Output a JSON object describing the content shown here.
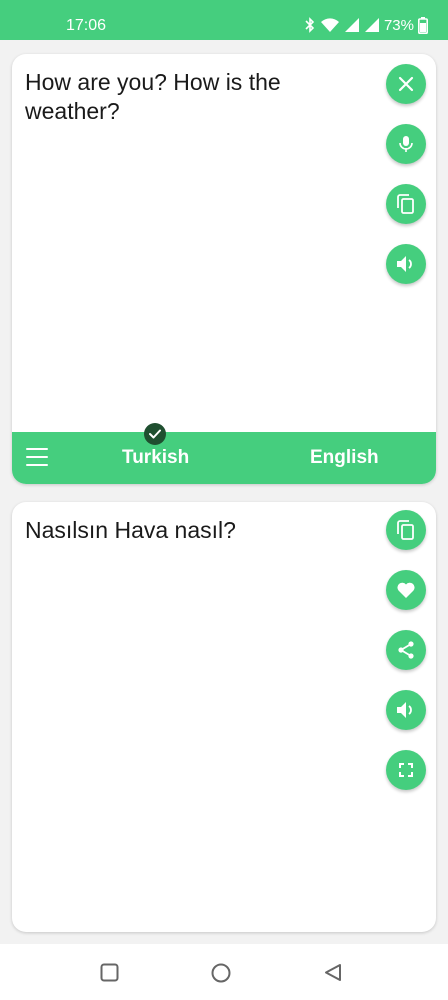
{
  "status_bar": {
    "time": "17:06",
    "battery": "73%",
    "icons": [
      "bluetooth-icon",
      "wifi-icon",
      "signal-icon",
      "signal-icon",
      "battery-icon"
    ]
  },
  "source": {
    "text": "How are you? How is the weather?",
    "actions": [
      "close-icon",
      "microphone-icon",
      "copy-icon",
      "speaker-icon"
    ]
  },
  "language_bar": {
    "source_language": "Turkish",
    "target_language": "English",
    "menu_icon": "menu-icon",
    "selected_indicator": "checkmark-icon"
  },
  "target": {
    "text": "Nasılsın Hava nasıl?",
    "actions": [
      "copy-icon",
      "heart-icon",
      "share-icon",
      "speaker-icon",
      "fullscreen-icon"
    ]
  },
  "nav_bar": {
    "buttons": [
      "recents-square-icon",
      "home-circle-icon",
      "back-triangle-icon"
    ]
  },
  "colors": {
    "accent": "#45ce7e",
    "badge": "#1f4f30",
    "card": "#ffffff",
    "background": "#f2f2f2",
    "text": "#1a1a1a"
  }
}
